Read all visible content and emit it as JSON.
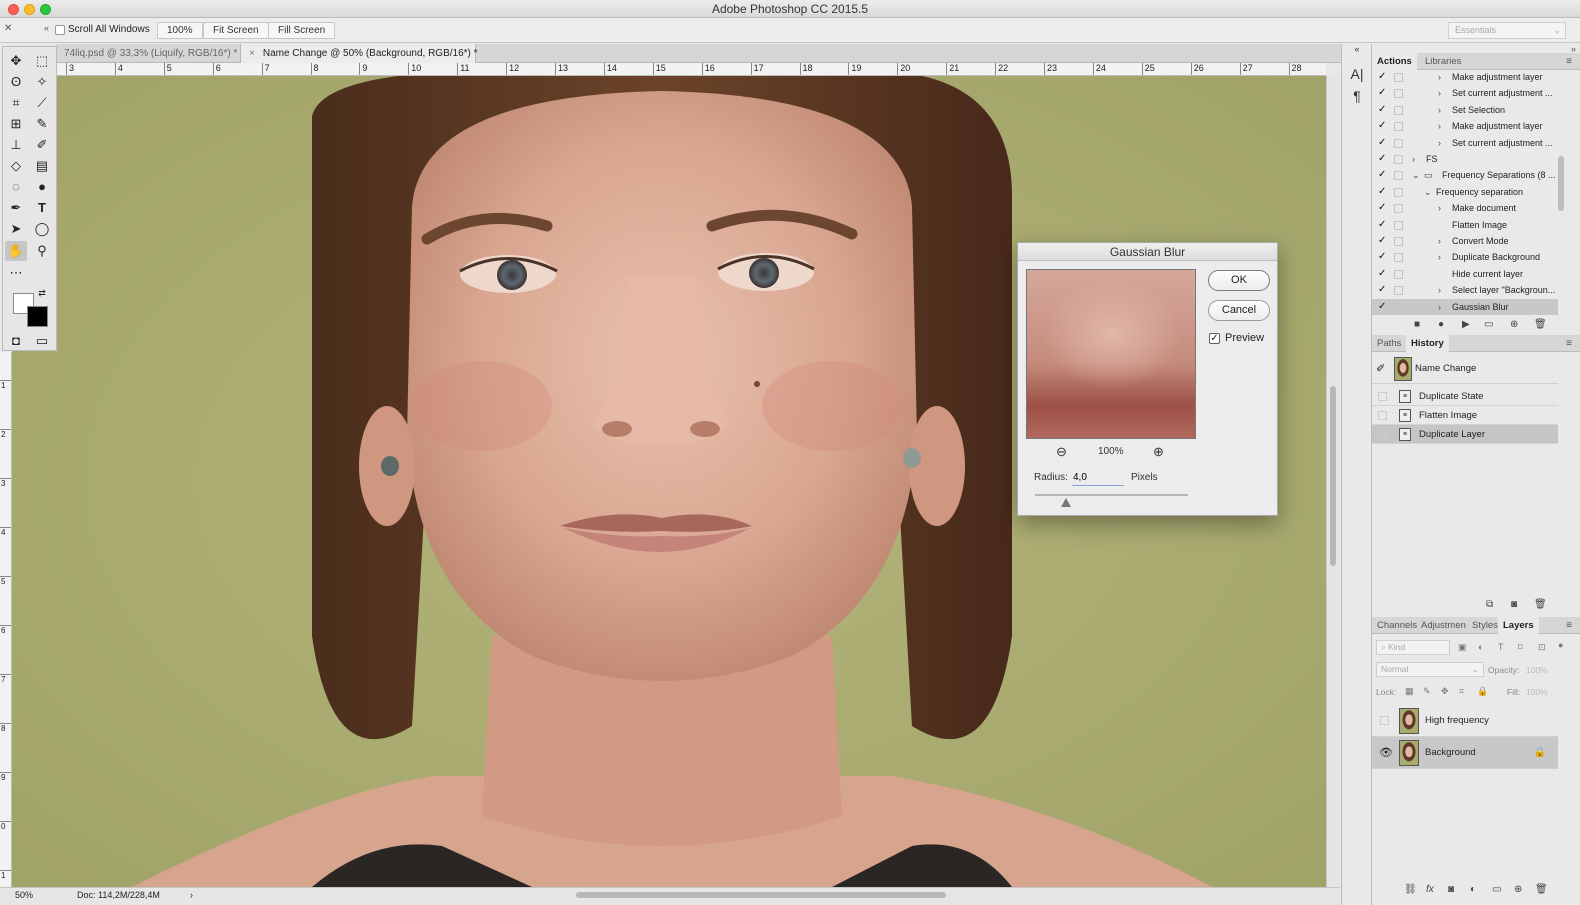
{
  "window": {
    "title": "Adobe Photoshop CC 2015.5"
  },
  "options_bar": {
    "scroll_all_label": "Scroll All Windows",
    "zoom_100": "100%",
    "fit_screen": "Fit Screen",
    "fill_screen": "Fill Screen",
    "workspace": "Essentials"
  },
  "tabs": [
    {
      "label": "74liq.psd @ 33,3% (Liquify, RGB/16*) *"
    },
    {
      "label": "Name Change @ 50% (Background, RGB/16*) *"
    }
  ],
  "ruler": {
    "top": [
      "3",
      "4",
      "5",
      "6",
      "7",
      "8",
      "9",
      "10",
      "11",
      "12",
      "13",
      "14",
      "15",
      "16",
      "17",
      "18",
      "19",
      "20",
      "21",
      "22",
      "23",
      "24",
      "25",
      "26",
      "27",
      "28"
    ],
    "left": [
      "1",
      "2",
      "3",
      "4",
      "5",
      "6",
      "7",
      "8",
      "9",
      "0",
      "1"
    ]
  },
  "status": {
    "zoom": "50%",
    "doc": "Doc: 114,2M/228,4M"
  },
  "dialog": {
    "title": "Gaussian Blur",
    "ok": "OK",
    "cancel": "Cancel",
    "preview_label": "Preview",
    "preview_checked": true,
    "zoom": "100%",
    "radius_label": "Radius:",
    "radius_value": "4,0",
    "units": "Pixels",
    "radius_fraction": 0.2
  },
  "actions_panel": {
    "tabs": [
      "Actions",
      "Libraries"
    ],
    "rows": [
      {
        "label": "Make adjustment layer",
        "level": 2
      },
      {
        "label": "Set current adjustment ...",
        "level": 2
      },
      {
        "label": "Set Selection",
        "level": 2
      },
      {
        "label": "Make adjustment layer",
        "level": 2
      },
      {
        "label": "Set current adjustment ...",
        "level": 2
      },
      {
        "label": "FS",
        "level": 0
      },
      {
        "label": "Frequency Separations (8 ...",
        "level": 0
      },
      {
        "label": "Frequency separation",
        "level": 1
      },
      {
        "label": "Make document",
        "level": 2
      },
      {
        "label": "Flatten Image",
        "level": 2
      },
      {
        "label": "Convert Mode",
        "level": 2
      },
      {
        "label": "Duplicate Background",
        "level": 2
      },
      {
        "label": "Hide current layer",
        "level": 2
      },
      {
        "label": "Select layer \"Backgroun...",
        "level": 2
      },
      {
        "label": "Gaussian Blur",
        "level": 2
      }
    ]
  },
  "history_panel": {
    "tabs": [
      "Paths",
      "History"
    ],
    "snapshot": "Name Change",
    "rows": [
      "Duplicate State",
      "Flatten Image",
      "Duplicate Layer"
    ]
  },
  "layers_panel": {
    "tabs": [
      "Channels",
      "Adjustmen",
      "Styles",
      "Layers"
    ],
    "kind_placeholder": "Kind",
    "blend_mode": "Normal",
    "opacity_label": "Opacity:",
    "opacity_value": "100%",
    "lock_label": "Lock:",
    "fill_label": "Fill:",
    "fill_value": "100%",
    "layers": [
      {
        "name": "High frequency",
        "visible": false
      },
      {
        "name": "Background",
        "visible": true
      }
    ]
  },
  "colors": {
    "backdrop": "#a8ab6e",
    "selection": "#c5c5c5",
    "accent": "#4a7bd0"
  }
}
